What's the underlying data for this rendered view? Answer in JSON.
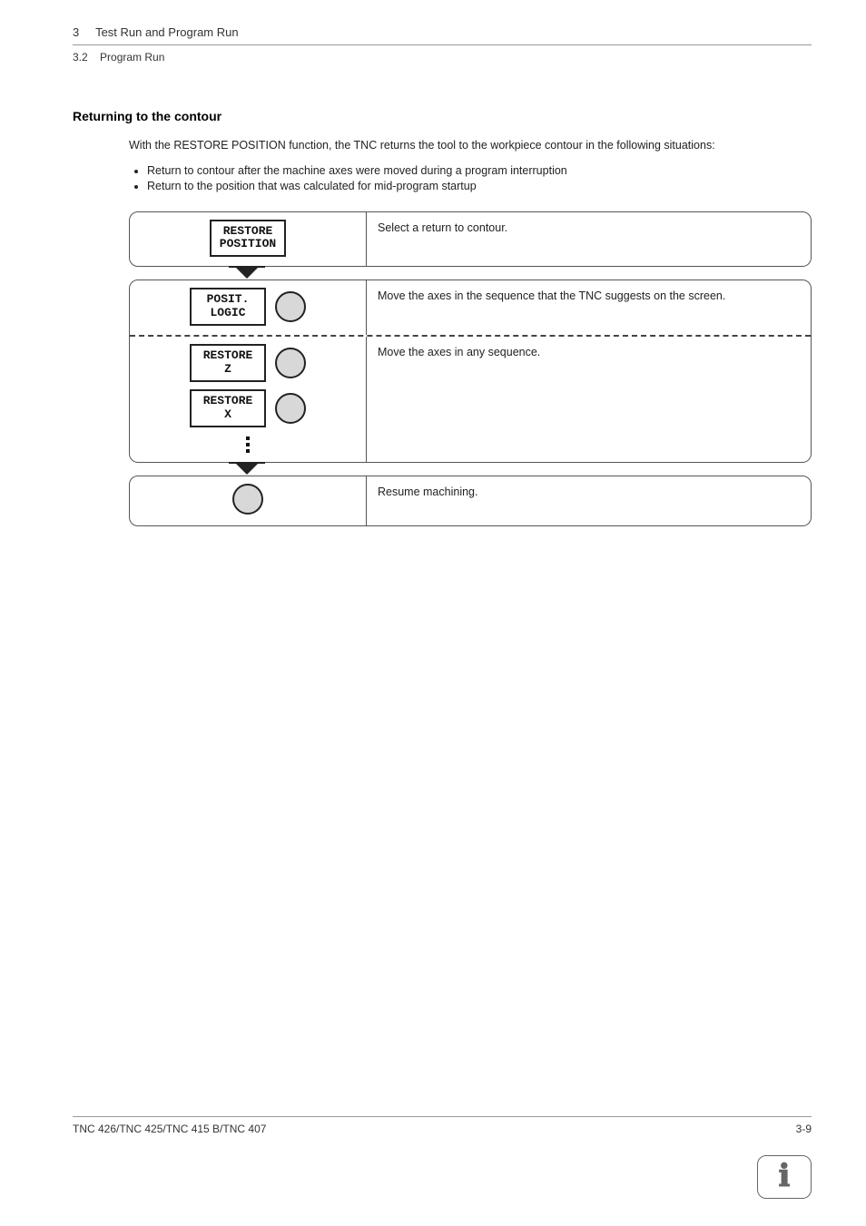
{
  "header": {
    "chapter_num": "3",
    "chapter_title": "Test Run and Program Run",
    "section_num": "3.2",
    "section_title": "Program Run"
  },
  "heading": "Returning to the contour",
  "intro": "With the RESTORE POSITION function, the TNC returns the tool to the workpiece contour in the following situations:",
  "bullets": [
    "Return to contour after the machine axes were moved during a program interruption",
    "Return to the position that was calculated for mid-program startup"
  ],
  "steps": {
    "step1": {
      "button_line1": "RESTORE",
      "button_line2": "POSITION",
      "desc": "Select a return to contour."
    },
    "step2a": {
      "button_line1": "POSIT.",
      "button_line2": "LOGIC",
      "desc": "Move the axes in the sequence that the TNC suggests on the screen."
    },
    "step2b": {
      "button1_line1": "RESTORE",
      "button1_line2": "Z",
      "button2_line1": "RESTORE",
      "button2_line2": "X",
      "desc": "Move the axes in any sequence."
    },
    "step3": {
      "desc": "Resume machining."
    }
  },
  "footer": {
    "left": "TNC 426/TNC 425/TNC 415 B/TNC 407",
    "right": "3-9"
  }
}
